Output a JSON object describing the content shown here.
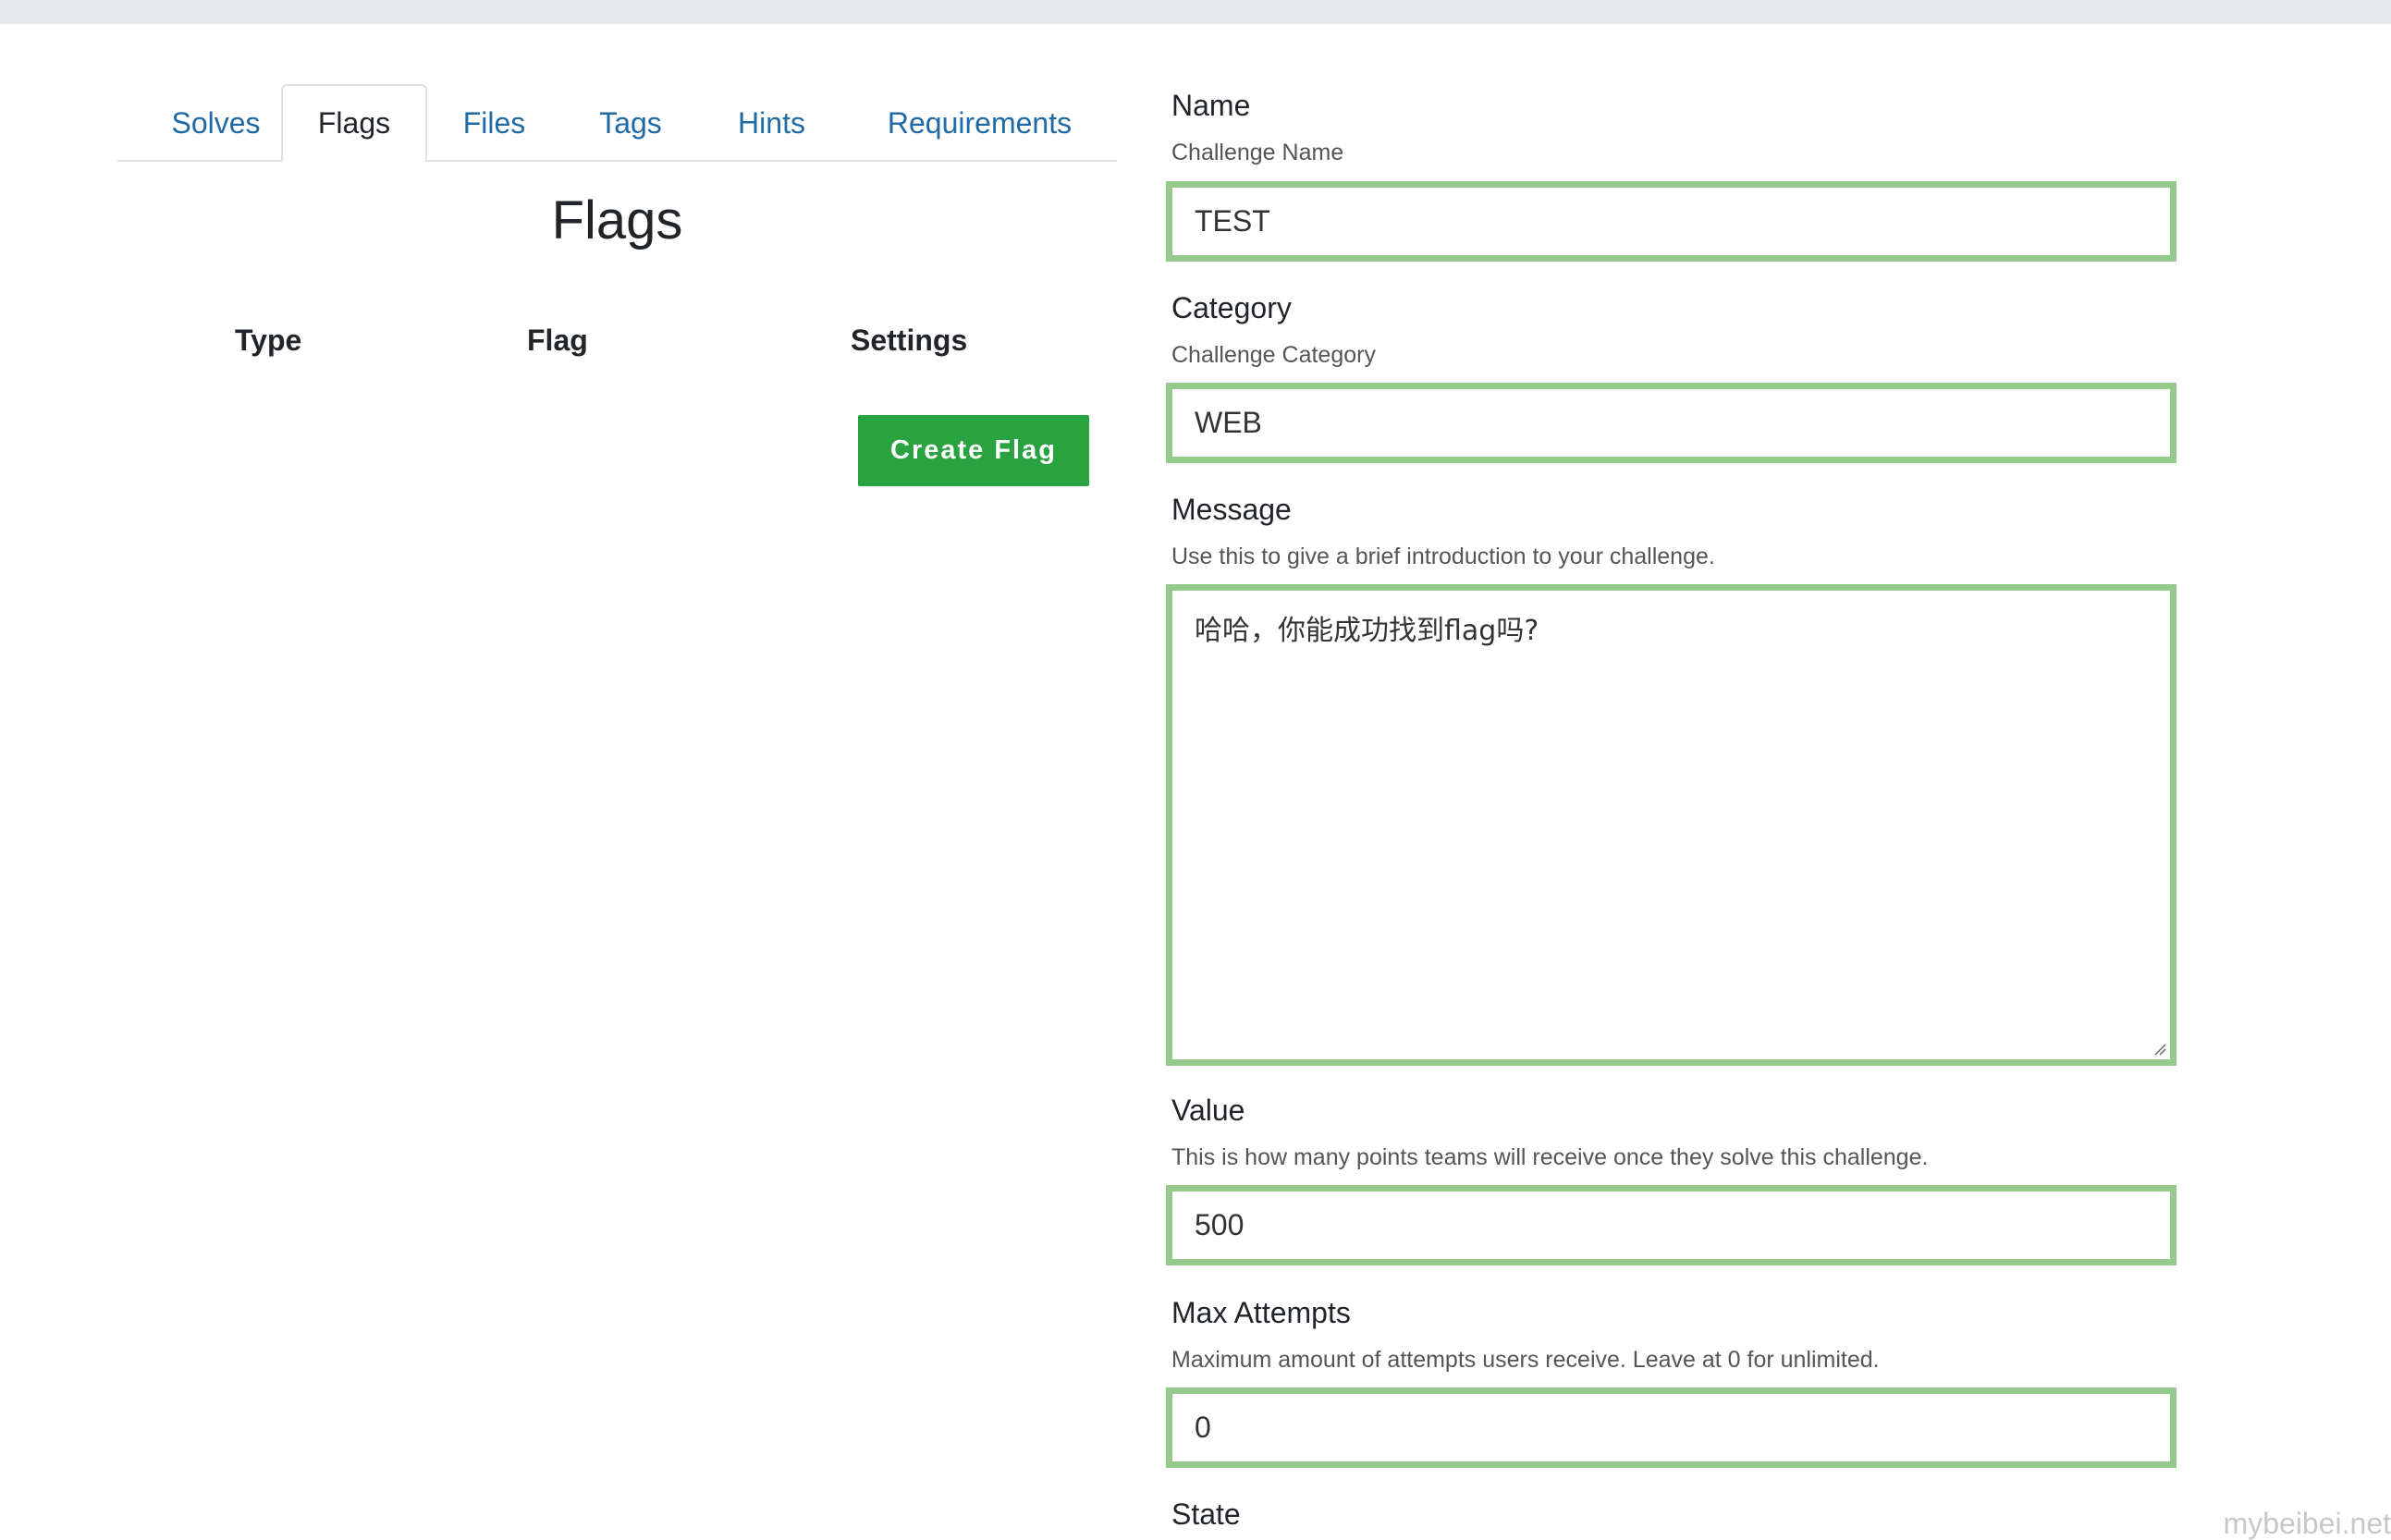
{
  "tabs": [
    {
      "label": "Solves",
      "active": false
    },
    {
      "label": "Flags",
      "active": true
    },
    {
      "label": "Files",
      "active": false
    },
    {
      "label": "Tags",
      "active": false
    },
    {
      "label": "Hints",
      "active": false
    },
    {
      "label": "Requirements",
      "active": false
    }
  ],
  "flags_panel": {
    "title": "Flags",
    "columns": [
      "Type",
      "Flag",
      "Settings"
    ],
    "create_button": "Create Flag"
  },
  "form": {
    "name": {
      "label": "Name",
      "help": "Challenge Name",
      "value": "TEST"
    },
    "category": {
      "label": "Category",
      "help": "Challenge Category",
      "value": "WEB"
    },
    "message": {
      "label": "Message",
      "help": "Use this to give a brief introduction to your challenge.",
      "value": "哈哈，你能成功找到flag吗?"
    },
    "value": {
      "label": "Value",
      "help": "This is how many points teams will receive once they solve this challenge.",
      "value": "500"
    },
    "max_attempts": {
      "label": "Max Attempts",
      "help": "Maximum amount of attempts users receive. Leave at 0 for unlimited.",
      "value": "0"
    },
    "state": {
      "label": "State"
    }
  },
  "watermark": "mybeibei.net",
  "colors": {
    "accent_green": "#28a33f",
    "field_border": "#96c98c",
    "tab_link": "#1f6aa5"
  }
}
